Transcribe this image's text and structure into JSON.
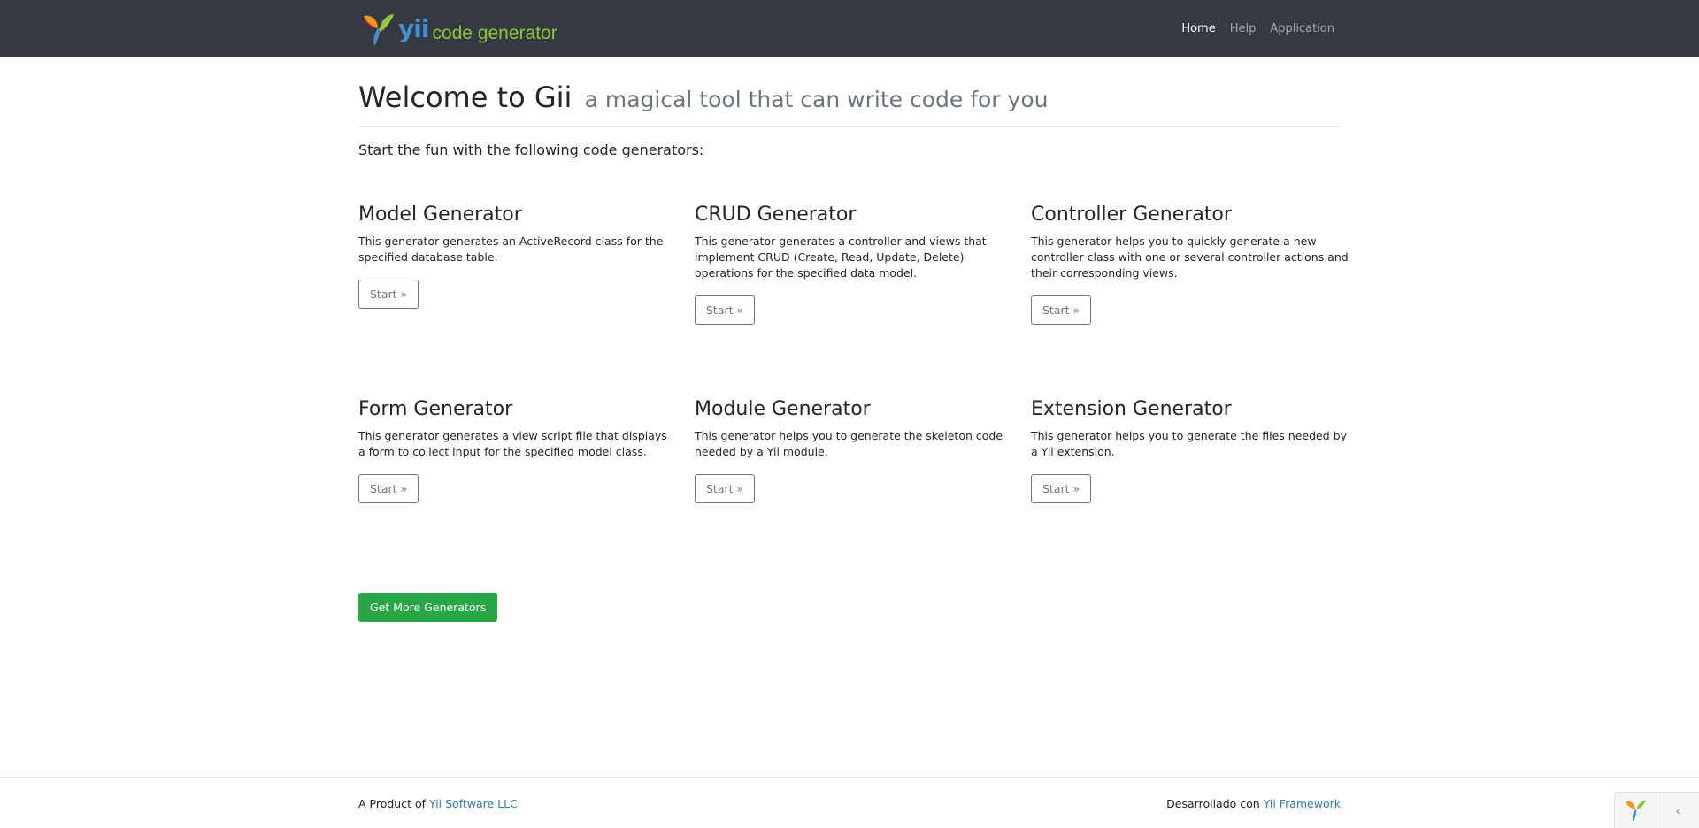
{
  "brand": {
    "logo_icon": "yii-logo-icon",
    "word_yii": "yii",
    "word_rest": "code generator"
  },
  "nav": {
    "items": [
      {
        "label": "Home",
        "active": true
      },
      {
        "label": "Help",
        "active": false
      },
      {
        "label": "Application",
        "active": false
      }
    ]
  },
  "header": {
    "title": "Welcome to Gii",
    "subtitle": "a magical tool that can write code for you"
  },
  "intro": "Start the fun with the following code generators:",
  "generators": [
    {
      "title": "Model Generator",
      "description": "This generator generates an ActiveRecord class for the specified database table.",
      "button": "Start »"
    },
    {
      "title": "CRUD Generator",
      "description": "This generator generates a controller and views that implement CRUD (Create, Read, Update, Delete) operations for the specified data model.",
      "button": "Start »"
    },
    {
      "title": "Controller Generator",
      "description": "This generator helps you to quickly generate a new controller class with one or several controller actions and their corresponding views.",
      "button": "Start »"
    },
    {
      "title": "Form Generator",
      "description": "This generator generates a view script file that displays a form to collect input for the specified model class.",
      "button": "Start »"
    },
    {
      "title": "Module Generator",
      "description": "This generator helps you to generate the skeleton code needed by a Yii module.",
      "button": "Start »"
    },
    {
      "title": "Extension Generator",
      "description": "This generator helps you to generate the files needed by a Yii extension.",
      "button": "Start »"
    }
  ],
  "more_button": "Get More Generators",
  "footer": {
    "left_prefix": "A Product of",
    "left_link": "Yii Software LLC",
    "right_prefix": "Desarrollado con",
    "right_link": "Yii Framework"
  },
  "debug": {
    "logo_icon": "yii-logo-icon",
    "toggle_icon": "chevron-left-icon",
    "toggle_glyph": "‹"
  },
  "colors": {
    "navbar": "#343a40",
    "brand_yii": "#3f8fd2",
    "brand_rest": "#8cc63f",
    "link": "#337ab7",
    "success": "#28a745"
  }
}
